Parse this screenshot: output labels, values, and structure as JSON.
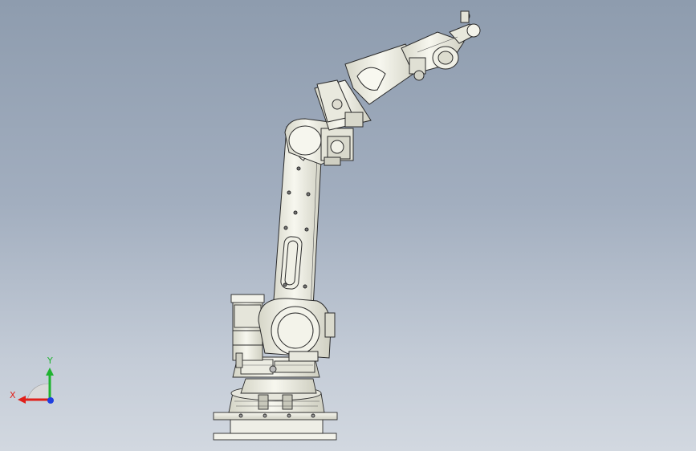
{
  "triad": {
    "x_label": "X",
    "y_label": "Y"
  },
  "colors": {
    "background_top": "#8e9cae",
    "background_bottom": "#d2d8e0",
    "part_fill": "#f4f4ec",
    "part_shade": "#d9d9cd",
    "outline": "#2a2a2a",
    "axis_x": "#e0201a",
    "axis_y": "#1fb330",
    "axis_z": "#1f3fe0"
  }
}
